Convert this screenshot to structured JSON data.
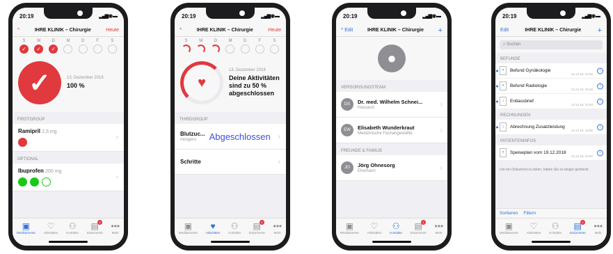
{
  "status_time": "20:19",
  "tabs": [
    "Medikamente",
    "Aktivitäten",
    "Kontakte",
    "Dokumente",
    "Mehr"
  ],
  "tab_icons": [
    "pill-box-icon",
    "heart-icon",
    "person-icon",
    "document-icon",
    "more-icon"
  ],
  "badge": "3",
  "colors": {
    "accent_red": "#e0393e",
    "accent_blue": "#2f6fdb",
    "pill_green": "#19c919"
  },
  "screen1": {
    "nav": {
      "back": "^",
      "title": "IHRE KLINIK – Chirurgie",
      "action": "Heute"
    },
    "days": [
      "S",
      "M",
      "D",
      "M",
      "D",
      "F",
      "S"
    ],
    "date": "13. Dezember 2018",
    "value": "100 %",
    "section1": "FIRSTGROUP",
    "med1": {
      "name": "Ramipril",
      "dose": "2,5 mg"
    },
    "section2": "OPTIONAL",
    "med2": {
      "name": "Ibuprofen",
      "dose": "200 mg"
    }
  },
  "screen2": {
    "nav": {
      "back": "^",
      "title": "IHRE KLINIK – Chirurgie",
      "action": "Heute"
    },
    "days": [
      "S",
      "M",
      "D",
      "M",
      "D",
      "F",
      "S"
    ],
    "date": "13. Dezember 2018",
    "message": "Deine Aktivitäten sind zu 50 % abgeschlossen",
    "section": "THIRDGROUP",
    "act1": {
      "name": "Blutzuc...",
      "sub": "morgens",
      "status": "Abgeschlossen"
    },
    "act2": {
      "name": "Schritte"
    }
  },
  "screen3": {
    "nav": {
      "edit": "Edit",
      "title": "IHRE KLINIK – Chirurgie",
      "add": "+"
    },
    "section1": "VERSORGUNGSTEAM",
    "c1": {
      "initials": "DS",
      "name": "Dr. med. Wilhelm Schnei...",
      "role": "Hausarzt"
    },
    "c2": {
      "initials": "EW",
      "name": "Elisabeth Wunderkraut",
      "role": "Medizinische Fachangestellte"
    },
    "section2": "FREUNDE & FAMILIE",
    "c3": {
      "initials": "JO",
      "name": "Jörg Ohnesorg",
      "role": "Ehemann"
    }
  },
  "screen4": {
    "nav": {
      "edit": "Edit",
      "title": "IHRE KLINIK – Chirurgie",
      "add": "+"
    },
    "search": "Suchen",
    "section1": "BEFUNDE",
    "d1": {
      "name": "Befund Gynäkologie",
      "date": "13.12.18, 10:52"
    },
    "d2": {
      "name": "Befund Radiologie",
      "date": "13.12.18, 10:46"
    },
    "d3": {
      "name": "Entlassbrief",
      "date": "13.12.18, 10:50"
    },
    "section2": "RECHNUNGEN",
    "d4": {
      "name": "Abrechnung Zusatzleistung",
      "date": "13.12.18, 10:50"
    },
    "section3": "PATIENTENINFOS",
    "d5": {
      "name": "Speiseplan vom 19.12.2018",
      "date": "13.12.18, 10:52"
    },
    "note": "Um ein Dokument zu teilen, halten Sie es länger gedrückt.",
    "sort": "Sortieren",
    "filter": "Filtern"
  }
}
